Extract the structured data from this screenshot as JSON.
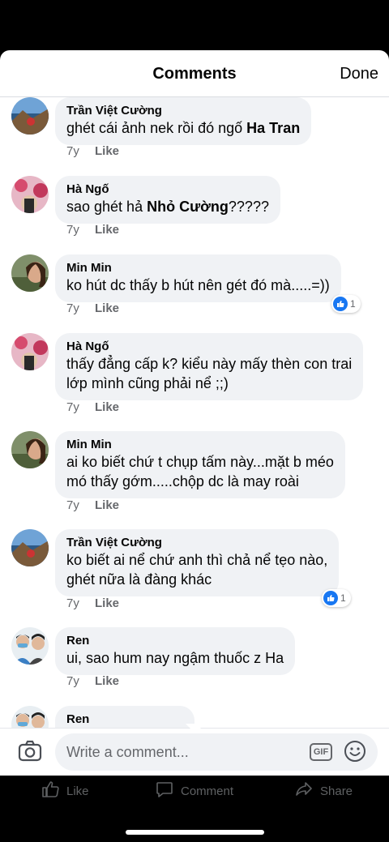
{
  "header": {
    "title": "Comments",
    "done_label": "Done"
  },
  "comments": [
    {
      "author": "Trần Việt Cường",
      "text_pre": "ghét cái ảnh nek rồi đó ngố ",
      "mention": "Ha Tran",
      "text_post": "",
      "age": "7y",
      "like_label": "Like",
      "reactions": "",
      "avatar": "landscape-coast"
    },
    {
      "author": "Hà Ngố",
      "text_pre": "sao ghét hả ",
      "mention": "Nhỏ Cường",
      "text_post": "?????",
      "age": "7y",
      "like_label": "Like",
      "reactions": "",
      "avatar": "pink-floral"
    },
    {
      "author": "Min Min",
      "text_pre": "ko hút dc thấy b hút nên gét đó mà.....=))",
      "mention": "",
      "text_post": "",
      "age": "7y",
      "like_label": "Like",
      "reactions": "1",
      "avatar": "woman-portrait"
    },
    {
      "author": "Hà Ngố",
      "text_pre": "thấy đẳng cấp k? kiểu này mấy thèn con trai\nlớp mình cũng phải nể ;;)",
      "mention": "",
      "text_post": "",
      "age": "7y",
      "like_label": "Like",
      "reactions": "",
      "avatar": "pink-floral"
    },
    {
      "author": "Min Min",
      "text_pre": "ai ko biết chứ t chụp tấm này...mặt b méo\nmó thấy gớm.....chộp dc là may roài",
      "mention": "",
      "text_post": "",
      "age": "7y",
      "like_label": "Like",
      "reactions": "",
      "avatar": "woman-portrait"
    },
    {
      "author": "Trần Việt Cường",
      "text_pre": "ko biết ai nể chứ anh thì chả nể tẹo nào,\nghét nữa là đàng khác",
      "mention": "",
      "text_post": "",
      "age": "7y",
      "like_label": "Like",
      "reactions": "1",
      "avatar": "landscape-coast"
    },
    {
      "author": "Ren",
      "text_pre": "ui, sao hum nay ngậm thuốc z Ha",
      "mention": "",
      "text_post": "",
      "age": "7y",
      "like_label": "Like",
      "reactions": "",
      "avatar": "couple"
    },
    {
      "author": "Ren",
      "text_pre": "",
      "mention": "",
      "text_post": "",
      "age": "",
      "like_label": "",
      "reactions": "",
      "avatar": "couple"
    }
  ],
  "composer": {
    "placeholder": "Write a comment...",
    "gif_label": "GIF"
  },
  "actionbar": {
    "like": "Like",
    "comment": "Comment",
    "share": "Share"
  },
  "colors": {
    "accent": "#1877f2",
    "bubble": "#f0f2f5",
    "secondary_text": "#65676b"
  }
}
